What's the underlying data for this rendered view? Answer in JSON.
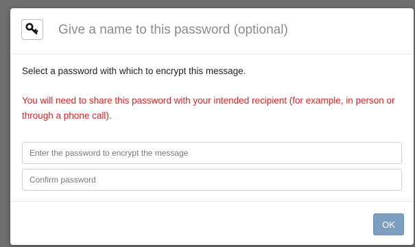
{
  "dialog": {
    "key_icon": "key-icon",
    "name_field": {
      "placeholder": "Give a name to this password (optional)",
      "value": ""
    },
    "instruction": "Select a password with which to encrypt this message.",
    "warning": "You will need to share this password with your intended recipient (for example, in person or through a phone call).",
    "password_field": {
      "placeholder": "Enter the password to encrypt the message",
      "value": ""
    },
    "confirm_field": {
      "placeholder": "Confirm password",
      "value": ""
    },
    "ok_label": "OK"
  },
  "colors": {
    "warning_text": "#e02020",
    "ok_button": "#7d9fbf",
    "backdrop": "#6f6f6f"
  }
}
